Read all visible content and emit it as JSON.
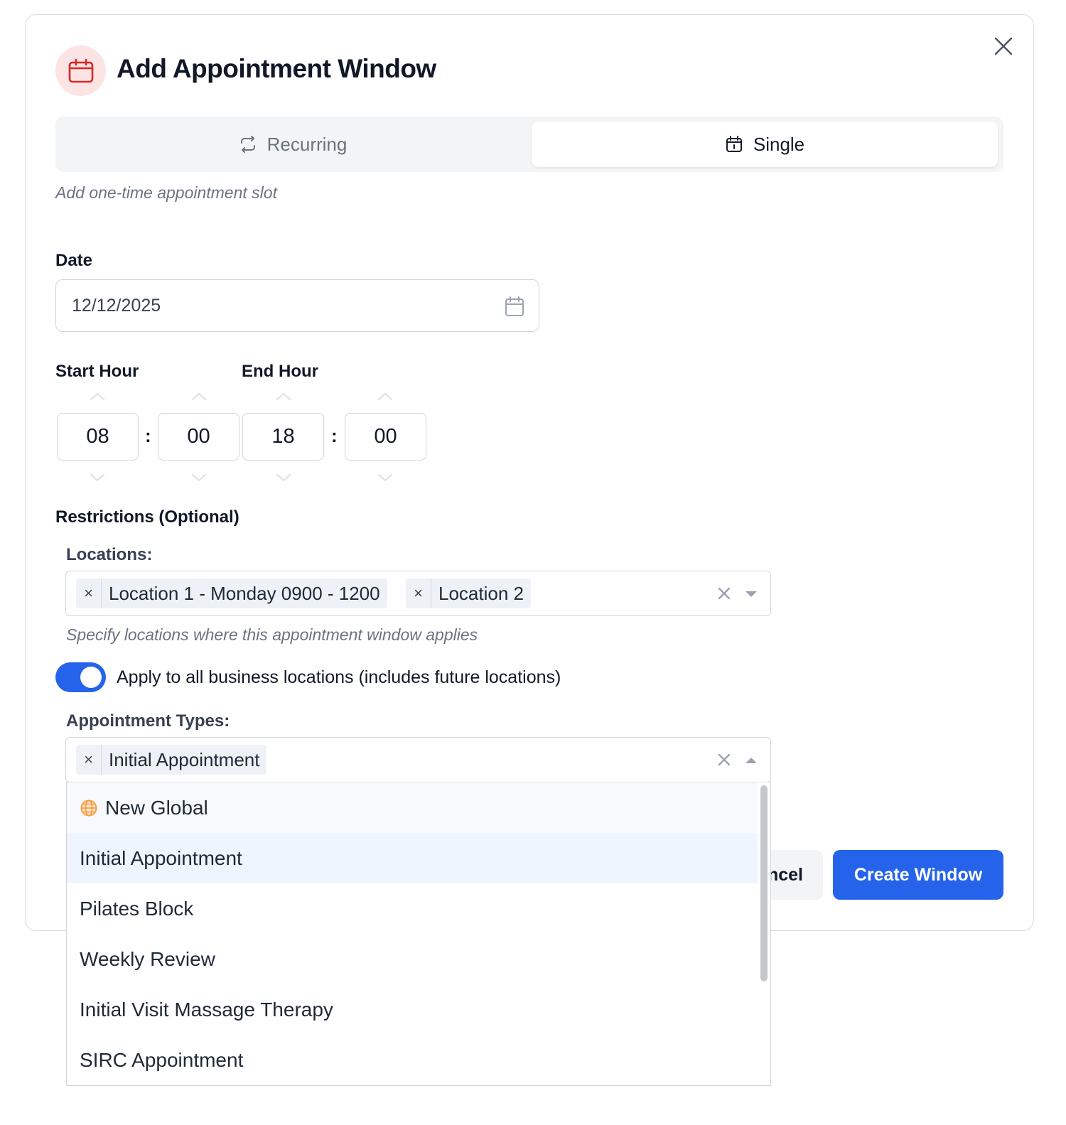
{
  "modal": {
    "title": "Add Appointment Window",
    "subtitle": "Add one-time appointment slot"
  },
  "tabs": [
    {
      "label": "Recurring",
      "active": false,
      "icon": "repeat-icon"
    },
    {
      "label": "Single",
      "active": true,
      "icon": "calendar-icon"
    }
  ],
  "date": {
    "label": "Date",
    "value": "12/12/2025"
  },
  "start_hour": {
    "label": "Start Hour",
    "hours": "08",
    "minutes": "00"
  },
  "end_hour": {
    "label": "End Hour",
    "hours": "18",
    "minutes": "00"
  },
  "restrictions": {
    "label": "Restrictions (Optional)",
    "locations": {
      "label": "Locations:",
      "selected": [
        "Location 1 - Monday 0900 - 1200",
        "Location 2"
      ],
      "hint": "Specify locations where this appointment window applies"
    },
    "apply_all": {
      "label": "Apply to all business locations (includes future locations)",
      "enabled": true
    },
    "appointment_types": {
      "label": "Appointment Types:",
      "selected": [
        "Initial Appointment"
      ],
      "options": [
        "New Global",
        "Initial Appointment",
        "Pilates Block",
        "Weekly Review",
        "Initial Visit Massage Therapy",
        "SIRC Appointment"
      ]
    }
  },
  "footer": {
    "cancel_label": "ncel",
    "create_label": "Create Window"
  },
  "colors": {
    "primary": "#2563eb",
    "icon_bg": "#fde4e4",
    "icon_red": "#dc2626",
    "globe": "#f59e42"
  }
}
